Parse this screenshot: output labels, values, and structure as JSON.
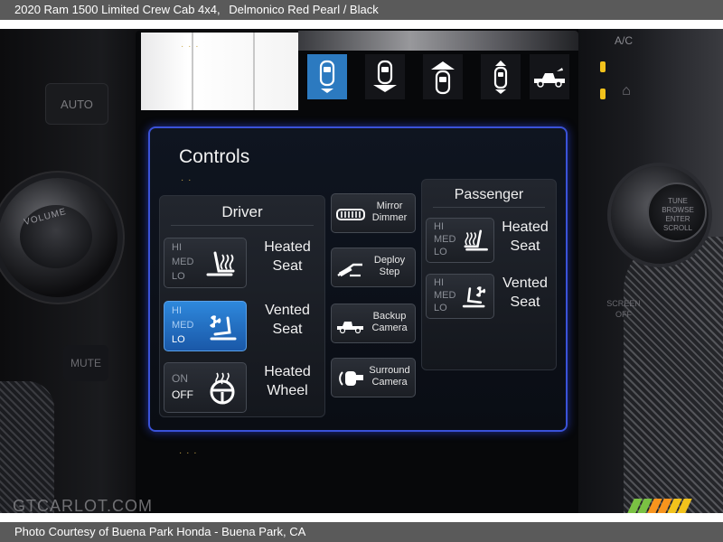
{
  "caption": {
    "vehicle": "2020 Ram 1500 Limited Crew Cab 4x4,",
    "color": "Delmonico Red Pearl / Black",
    "credit": "Photo Courtesy of Buena Park Honda - Buena Park, CA"
  },
  "watermark": "GTCARLOT.COM",
  "dashboard": {
    "auto_label": "AUTO",
    "volume_label": "VOLUME",
    "mute_label": "MUTE",
    "ac_label": "A/C",
    "knob_lines": [
      "TUNE",
      "BROWSE",
      "ENTER",
      "SCROLL"
    ],
    "screen_off": [
      "SCREEN",
      "OFF"
    ]
  },
  "screen": {
    "tabs": [
      {
        "icon": "car-top-down-icon",
        "active": true
      },
      {
        "icon": "car-lower-icon",
        "active": false
      },
      {
        "icon": "car-raise-icon",
        "active": false
      },
      {
        "icon": "car-raise-lower-icon",
        "active": false
      },
      {
        "icon": "truck-side-icon",
        "active": false
      }
    ],
    "panel_title": "Controls",
    "driver": {
      "title": "Driver",
      "heated_seat": {
        "levels": [
          "HI",
          "MED",
          "LO"
        ],
        "label": [
          "Heated",
          "Seat"
        ],
        "active": false,
        "selected": null
      },
      "vented_seat": {
        "levels": [
          "HI",
          "MED",
          "LO"
        ],
        "label": [
          "Vented",
          "Seat"
        ],
        "active": true,
        "selected": "LO"
      },
      "heated_wheel": {
        "levels": [
          "ON",
          "OFF"
        ],
        "label": [
          "Heated",
          "Wheel"
        ],
        "active": false,
        "selected": "OFF"
      }
    },
    "middle": [
      {
        "label": [
          "Mirror",
          "Dimmer"
        ],
        "icon": "mirror-dimmer-icon"
      },
      {
        "label": [
          "Deploy",
          "Step"
        ],
        "icon": "deploy-step-icon"
      },
      {
        "label": [
          "Backup",
          "Camera"
        ],
        "icon": "backup-camera-icon"
      },
      {
        "label": [
          "Surround",
          "Camera"
        ],
        "icon": "surround-camera-icon"
      }
    ],
    "passenger": {
      "title": "Passenger",
      "heated_seat": {
        "levels": [
          "HI",
          "MED",
          "LO"
        ],
        "label": [
          "Heated",
          "Seat"
        ],
        "active": false,
        "selected": null
      },
      "vented_seat": {
        "levels": [
          "HI",
          "MED",
          "LO"
        ],
        "label": [
          "Vented",
          "Seat"
        ],
        "active": false,
        "selected": null
      }
    }
  },
  "colors": {
    "panel_border": "#3a52d8",
    "active_button": "#2e88dc",
    "stripes": [
      "#7ac143",
      "#7ac143",
      "#f7941d",
      "#f7941d",
      "#f2c21c",
      "#f2c21c"
    ]
  }
}
